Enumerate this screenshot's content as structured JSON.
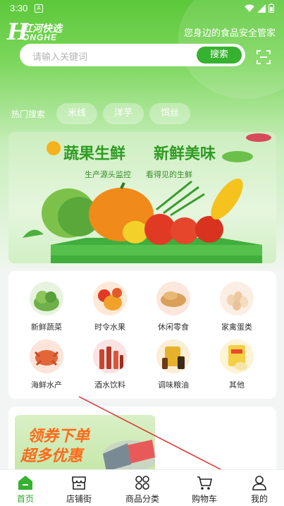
{
  "status_bar": {
    "time": "3:30",
    "notif_glyph": "A"
  },
  "header": {
    "logo_big": "H",
    "logo_cn": "红河快选",
    "logo_en": "ONGHE",
    "slogan": "您身边的食品安全管家"
  },
  "search": {
    "placeholder": "请输入关键词",
    "button_label": "搜索"
  },
  "hot_search": {
    "label": "热门搜索",
    "terms": [
      "米线",
      "洋芋",
      "饵丝"
    ]
  },
  "banner": {
    "title_1": "蔬果生鲜",
    "title_2": "新鲜美味",
    "subtitle_1": "生产源头监控",
    "subtitle_2": "看得见的生鲜"
  },
  "categories": [
    {
      "label": "新鲜蔬菜",
      "icon": "vegetables-icon",
      "color": "#6fb04a"
    },
    {
      "label": "时令水果",
      "icon": "fruit-icon",
      "color": "#f2a22a"
    },
    {
      "label": "休闲零食",
      "icon": "snacks-icon",
      "color": "#d9a05a"
    },
    {
      "label": "家禽蛋类",
      "icon": "eggs-icon",
      "color": "#f1d3b0"
    },
    {
      "label": "海鲜水产",
      "icon": "seafood-icon",
      "color": "#e2663a"
    },
    {
      "label": "酒水饮料",
      "icon": "drinks-icon",
      "color": "#c8452f"
    },
    {
      "label": "调味粮油",
      "icon": "condiments-icon",
      "color": "#e6b22a"
    },
    {
      "label": "其他",
      "icon": "other-icon",
      "color": "#f3d046"
    }
  ],
  "promo": {
    "line1": "领券下单",
    "line2": "超多优惠"
  },
  "tabbar": {
    "items": [
      {
        "label": "首页",
        "icon": "home-icon",
        "active": true
      },
      {
        "label": "店铺街",
        "icon": "store-icon",
        "active": false
      },
      {
        "label": "商品分类",
        "icon": "category-icon",
        "active": false
      },
      {
        "label": "购物车",
        "icon": "cart-icon",
        "active": false
      },
      {
        "label": "我的",
        "icon": "profile-icon",
        "active": false
      }
    ]
  },
  "colors": {
    "brand_green": "#36b230",
    "accent_orange": "#ff6a1a"
  }
}
